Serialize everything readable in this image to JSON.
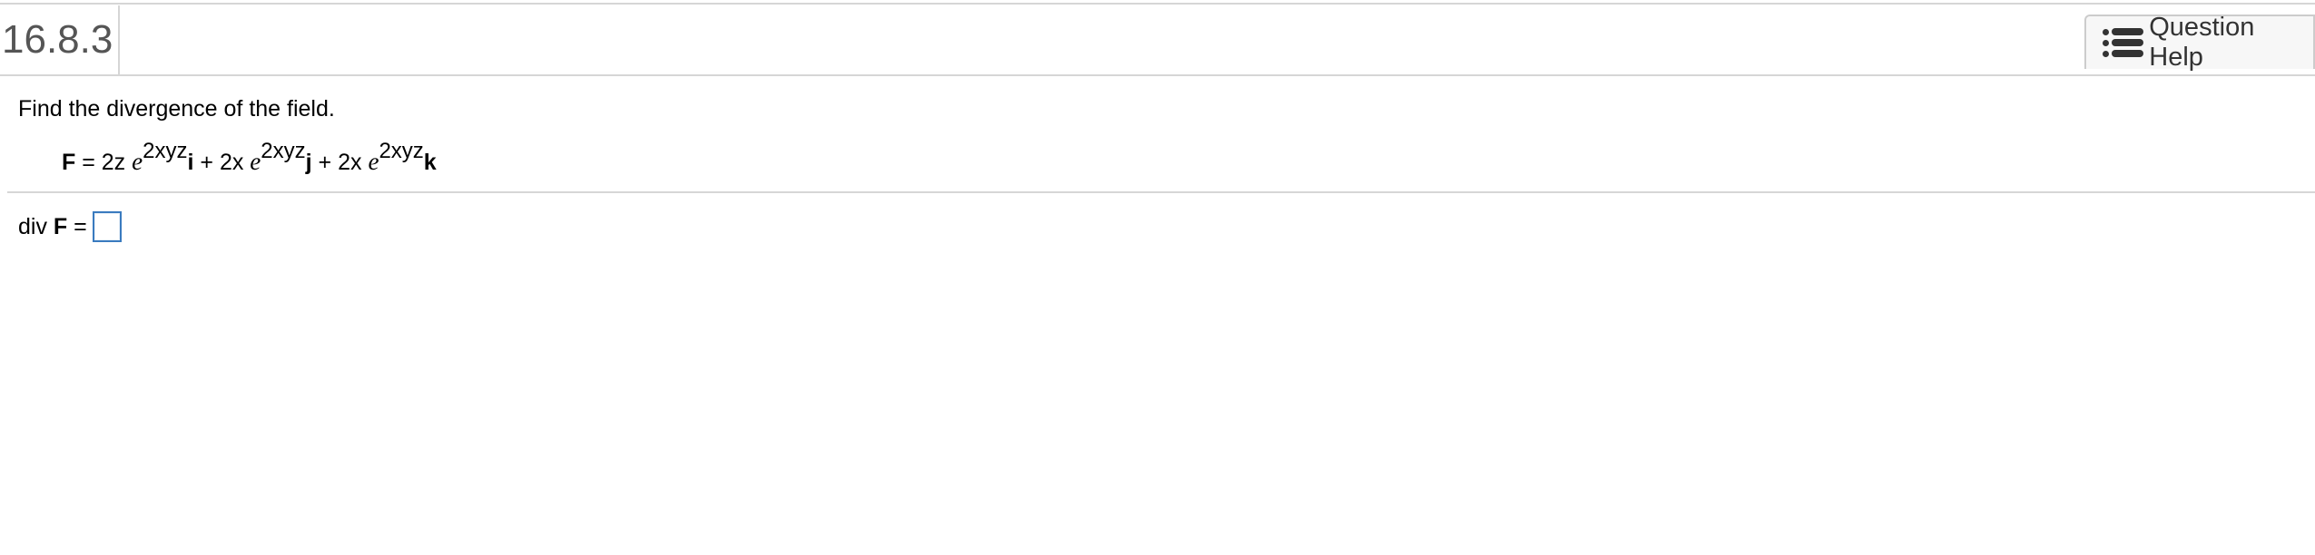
{
  "header": {
    "problem_number": "16.8.3",
    "help_button_label": "Question Help",
    "help_icon": "list-icon"
  },
  "question": {
    "instruction": "Find the divergence of the field.",
    "formula": {
      "lhs": "F",
      "eq": " = ",
      "t1_coef": "2z ",
      "t1_base": "e",
      "t1_exp": "2xyz",
      "t1_unit": "i",
      "plus1": " + ",
      "t2_coef": "2x ",
      "t2_base": "e",
      "t2_exp": "2xyz",
      "t2_unit": "j",
      "plus2": " + ",
      "t3_coef": "2x ",
      "t3_base": "e",
      "t3_exp": "2xyz",
      "t3_unit": "k"
    }
  },
  "answer": {
    "prefix": "div ",
    "field": "F",
    "eq": " =",
    "value": ""
  },
  "colors": {
    "border": "#d6d6d6",
    "input_border": "#3a7bbf",
    "header_text": "#555555"
  }
}
